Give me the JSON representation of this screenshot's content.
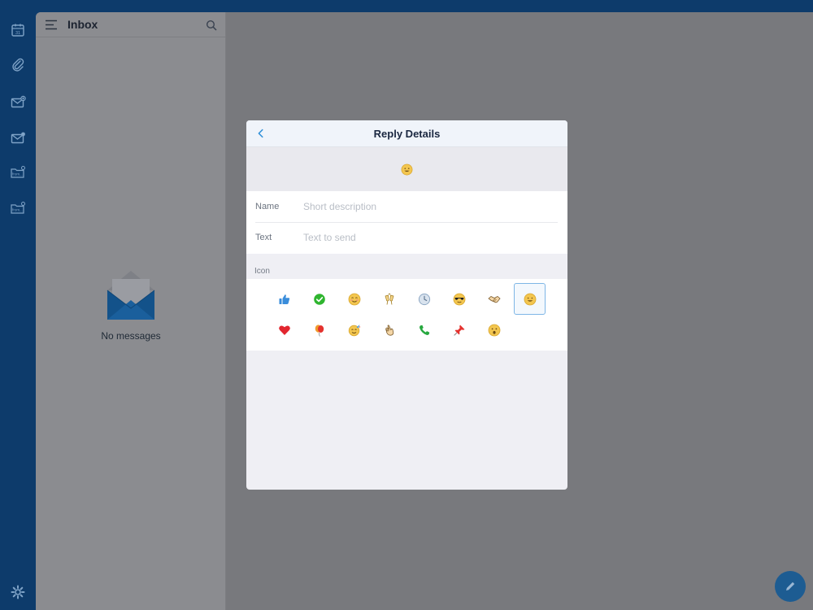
{
  "app": {
    "list_title": "Inbox",
    "empty_text": "No messages"
  },
  "rail": {
    "items": [
      {
        "name": "calendar-icon",
        "label": "31"
      },
      {
        "name": "attachment-icon"
      },
      {
        "name": "mail-add-icon"
      },
      {
        "name": "mail-notify-icon"
      },
      {
        "name": "folder-from-icon",
        "label": "from..."
      },
      {
        "name": "folder-from-icon",
        "label": "from..."
      },
      {
        "name": "settings-icon"
      }
    ]
  },
  "modal": {
    "title": "Reply Details",
    "fields": [
      {
        "label": "Name",
        "placeholder": "Short description"
      },
      {
        "label": "Text",
        "placeholder": "Text to send"
      }
    ],
    "icon_section_label": "Icon",
    "selected_icon": "smile-icon",
    "icons": [
      "thumbs-up-icon",
      "check-circle-icon",
      "blush-icon",
      "cheers-icon",
      "clock-icon",
      "sunglasses-icon",
      "handshake-icon",
      "smile-icon",
      "heart-icon",
      "balloon-icon",
      "party-icon",
      "ok-hand-icon",
      "phone-icon",
      "pin-icon",
      "surprised-icon"
    ]
  },
  "colors": {
    "rail": "#0d3b6b",
    "accent": "#2f8fd8",
    "overlay": "#78797d"
  }
}
